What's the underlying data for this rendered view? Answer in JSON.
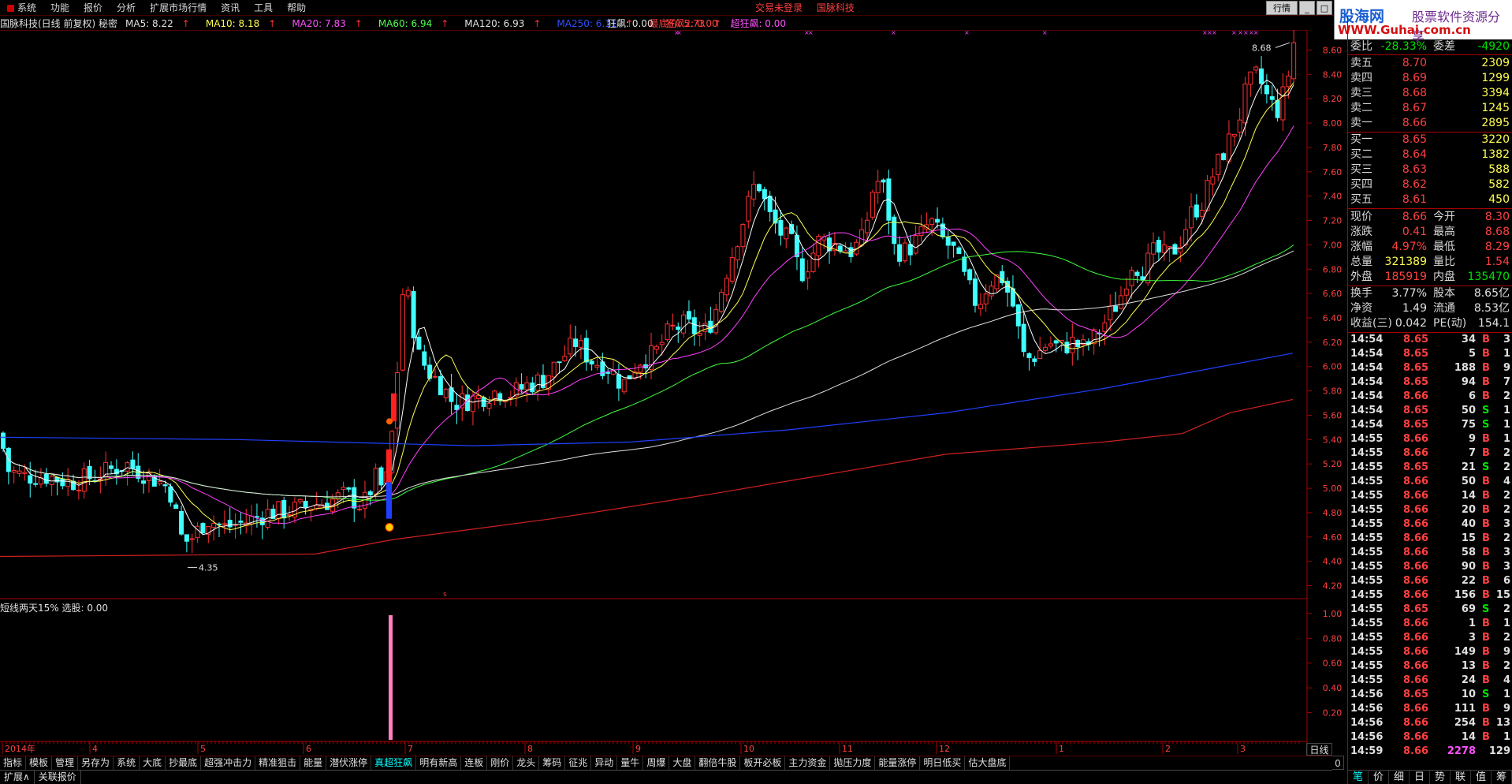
{
  "menu": {
    "items": [
      "系统",
      "功能",
      "报价",
      "分析",
      "扩展市场行情",
      "资讯",
      "工具",
      "帮助"
    ],
    "center": [
      "交易未登录",
      "国脉科技"
    ],
    "right_button": "行情",
    "window_buttons": [
      "_",
      "□"
    ]
  },
  "logo": {
    "brand": "股海网",
    "slogan": "股票软件资源分享",
    "url": "WWW.Guhai.com.cn"
  },
  "chart_header": {
    "title": "国脉科技(日线 前复权) 秘密",
    "ma": [
      {
        "label": "MA5: 8.22",
        "color": "#e0e0e0"
      },
      {
        "label": "MA10: 8.18",
        "color": "#ffff50"
      },
      {
        "label": "MA20: 7.83",
        "color": "#ff50ff"
      },
      {
        "label": "MA60: 6.94",
        "color": "#50ff50"
      },
      {
        "label": "MA120: 6.93",
        "color": "#e0e0e0"
      },
      {
        "label": "MA250: 6.11",
        "color": "#3050ff"
      },
      {
        "label": "最底价: 5.73",
        "color": "#ff4040"
      }
    ],
    "extra": [
      {
        "label": "狂飙: 0.00",
        "color": "#e0e0e0"
      },
      {
        "label": "狂飙2: 0.00",
        "color": "#ff4040"
      },
      {
        "label": "超狂飙: 0.00",
        "color": "#ff50ff"
      }
    ]
  },
  "chart_data": {
    "type": "candlestick",
    "y_axis_labels": [
      "8.60",
      "8.40",
      "8.20",
      "8.00",
      "7.80",
      "7.60",
      "7.40",
      "7.20",
      "7.00",
      "6.80",
      "6.60",
      "6.40",
      "6.20",
      "6.00",
      "5.80",
      "5.60",
      "5.40",
      "5.20",
      "5.00",
      "4.80",
      "4.60",
      "4.40",
      "4.20"
    ],
    "ylim": [
      4.1,
      8.7
    ],
    "x_axis_labels": [
      "2014年",
      "4",
      "5",
      "6",
      "7",
      "8",
      "9",
      "10",
      "11",
      "12",
      "1",
      "2",
      "3"
    ],
    "annotations": {
      "low": "4.35",
      "high": "8.68"
    },
    "sub_y_axis_labels": [
      "1.00",
      "0.80",
      "0.60",
      "0.40",
      "0.20"
    ]
  },
  "sub_chart": {
    "title": "短线两天15%  选股: 0.00"
  },
  "period": "日线",
  "zoom": [
    "+",
    "-",
    "0"
  ],
  "bottom_tabs": [
    "指标",
    "模板",
    "管理",
    "另存为",
    "系统",
    "大底",
    "抄最底",
    "超强冲击力",
    "精准狙击",
    "能量",
    "潜伏涨停",
    "真超狂飙",
    "明有新高",
    "连板",
    "刚价",
    "龙头",
    "筹码",
    "征兆",
    "异动",
    "量牛",
    "周爆",
    "大盘",
    "翻倍牛股",
    "板开必板",
    "主力资金",
    "拋压力度",
    "能量涨停",
    "明日低买",
    "估大盘底"
  ],
  "status_bar": [
    "扩展∧",
    "关联报价"
  ],
  "quote": {
    "weibi": {
      "label": "委比",
      "value": "-28.33%",
      "label2": "委差",
      "value2": "-4920"
    },
    "sells": [
      {
        "label": "卖五",
        "price": "8.70",
        "vol": "2309"
      },
      {
        "label": "卖四",
        "price": "8.69",
        "vol": "1299"
      },
      {
        "label": "卖三",
        "price": "8.68",
        "vol": "3394"
      },
      {
        "label": "卖二",
        "price": "8.67",
        "vol": "1245"
      },
      {
        "label": "卖一",
        "price": "8.66",
        "vol": "2895"
      }
    ],
    "buys": [
      {
        "label": "买一",
        "price": "8.65",
        "vol": "3220"
      },
      {
        "label": "买二",
        "price": "8.64",
        "vol": "1382"
      },
      {
        "label": "买三",
        "price": "8.63",
        "vol": "588"
      },
      {
        "label": "买四",
        "price": "8.62",
        "vol": "582"
      },
      {
        "label": "买五",
        "price": "8.61",
        "vol": "450"
      }
    ],
    "stats": [
      {
        "l1": "现价",
        "v1": "8.66",
        "c1": "#ff4040",
        "l2": "今开",
        "v2": "8.30",
        "c2": "#ff4040"
      },
      {
        "l1": "涨跌",
        "v1": "0.41",
        "c1": "#ff4040",
        "l2": "最高",
        "v2": "8.68",
        "c2": "#ff4040"
      },
      {
        "l1": "涨幅",
        "v1": "4.97%",
        "c1": "#ff4040",
        "l2": "最低",
        "v2": "8.29",
        "c2": "#ff4040"
      },
      {
        "l1": "总量",
        "v1": "321389",
        "c1": "#ffff50",
        "l2": "量比",
        "v2": "1.54",
        "c2": "#ff4040"
      },
      {
        "l1": "外盘",
        "v1": "185919",
        "c1": "#ff4040",
        "l2": "内盘",
        "v2": "135470",
        "c2": "#00e000"
      }
    ],
    "stats2": [
      {
        "l1": "换手",
        "v1": "3.77%",
        "l2": "股本",
        "v2": "8.65亿"
      },
      {
        "l1": "净资",
        "v1": "1.49",
        "l2": "流通",
        "v2": "8.53亿"
      },
      {
        "l1": "收益(三)",
        "v1": "0.042",
        "l2": "PE(动)",
        "v2": "154.1"
      }
    ]
  },
  "ticks": [
    {
      "t": "14:54",
      "p": "8.65",
      "v": "34",
      "d": "B",
      "n": "3"
    },
    {
      "t": "14:54",
      "p": "8.65",
      "v": "5",
      "d": "B",
      "n": "1"
    },
    {
      "t": "14:54",
      "p": "8.65",
      "v": "188",
      "d": "B",
      "n": "9"
    },
    {
      "t": "14:54",
      "p": "8.65",
      "v": "94",
      "d": "B",
      "n": "7"
    },
    {
      "t": "14:54",
      "p": "8.66",
      "v": "6",
      "d": "B",
      "n": "2"
    },
    {
      "t": "14:54",
      "p": "8.65",
      "v": "50",
      "d": "S",
      "n": "1"
    },
    {
      "t": "14:54",
      "p": "8.65",
      "v": "75",
      "d": "S",
      "n": "1"
    },
    {
      "t": "14:55",
      "p": "8.66",
      "v": "9",
      "d": "B",
      "n": "1"
    },
    {
      "t": "14:55",
      "p": "8.66",
      "v": "7",
      "d": "B",
      "n": "2"
    },
    {
      "t": "14:55",
      "p": "8.65",
      "v": "21",
      "d": "S",
      "n": "2"
    },
    {
      "t": "14:55",
      "p": "8.66",
      "v": "50",
      "d": "B",
      "n": "4"
    },
    {
      "t": "14:55",
      "p": "8.66",
      "v": "14",
      "d": "B",
      "n": "2"
    },
    {
      "t": "14:55",
      "p": "8.66",
      "v": "20",
      "d": "B",
      "n": "2"
    },
    {
      "t": "14:55",
      "p": "8.66",
      "v": "40",
      "d": "B",
      "n": "3"
    },
    {
      "t": "14:55",
      "p": "8.66",
      "v": "15",
      "d": "B",
      "n": "2"
    },
    {
      "t": "14:55",
      "p": "8.66",
      "v": "58",
      "d": "B",
      "n": "3"
    },
    {
      "t": "14:55",
      "p": "8.66",
      "v": "90",
      "d": "B",
      "n": "3"
    },
    {
      "t": "14:55",
      "p": "8.66",
      "v": "22",
      "d": "B",
      "n": "6"
    },
    {
      "t": "14:55",
      "p": "8.66",
      "v": "156",
      "d": "B",
      "n": "15"
    },
    {
      "t": "14:55",
      "p": "8.65",
      "v": "69",
      "d": "S",
      "n": "2"
    },
    {
      "t": "14:55",
      "p": "8.66",
      "v": "1",
      "d": "B",
      "n": "1"
    },
    {
      "t": "14:55",
      "p": "8.66",
      "v": "3",
      "d": "B",
      "n": "2"
    },
    {
      "t": "14:55",
      "p": "8.66",
      "v": "149",
      "d": "B",
      "n": "9"
    },
    {
      "t": "14:55",
      "p": "8.66",
      "v": "13",
      "d": "B",
      "n": "2"
    },
    {
      "t": "14:55",
      "p": "8.66",
      "v": "24",
      "d": "B",
      "n": "4"
    },
    {
      "t": "14:56",
      "p": "8.65",
      "v": "10",
      "d": "S",
      "n": "1"
    },
    {
      "t": "14:56",
      "p": "8.66",
      "v": "111",
      "d": "B",
      "n": "9"
    },
    {
      "t": "14:56",
      "p": "8.66",
      "v": "254",
      "d": "B",
      "n": "13"
    },
    {
      "t": "14:56",
      "p": "8.66",
      "v": "14",
      "d": "B",
      "n": "1"
    },
    {
      "t": "14:59",
      "p": "8.66",
      "v": "2278",
      "d": "",
      "n": "129"
    }
  ],
  "right_tabs": [
    "笔",
    "价",
    "细",
    "日",
    "势",
    "联",
    "值",
    "筹"
  ]
}
